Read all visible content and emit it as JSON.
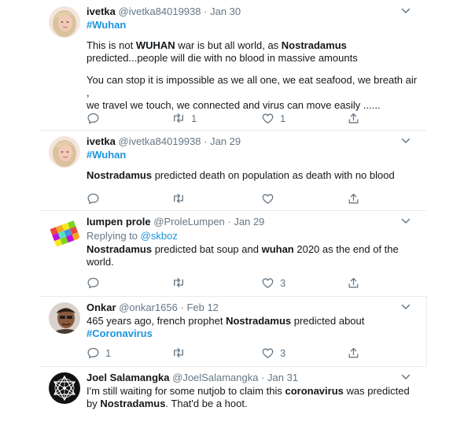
{
  "tweets": [
    {
      "name": "ivetka",
      "handle": "@ivetka84019938",
      "sep": "·",
      "date": "Jan 30",
      "hashtag": "#Wuhan",
      "text": [
        [
          "This is not ",
          "WUHAN",
          " war is but all world, as ",
          "Nostradamus"
        ],
        [
          " predicted...people will die with no blood  in massive amounts"
        ],
        [
          "You can stop it is impossible as we all one, we eat seafood, we breath air ,"
        ],
        [
          " we travel  we touch, we connected and virus can move easily ......"
        ]
      ],
      "retweets": "1",
      "likes": "1",
      "colors": {
        "avatar_bg": "#f3e4dc",
        "hair": "#d9c29c",
        "face": "#f2cbb8"
      }
    },
    {
      "name": "ivetka",
      "handle": "@ivetka84019938",
      "sep": "·",
      "date": "Jan 29",
      "hashtag": "#Wuhan",
      "bold": "Nostradamus",
      "rest": " predicted death on population as death with no blood"
    },
    {
      "name": "lumpen prole",
      "handle": "@ProleLumpen",
      "sep": "·",
      "date": "Jan 29",
      "replying": "Replying to ",
      "mention": "@skboz",
      "line1_b1": "Nostradamus",
      "line1_m": " predicted bat soup and ",
      "line1_b2": "wuhan",
      "line1_e": " 2020 as the end of the",
      "line2": "world.",
      "likes": "3"
    },
    {
      "name": "Onkar",
      "handle": "@onkar1656",
      "sep": "·",
      "date": "Feb 12",
      "line1_a": "465 years ago, french prophet ",
      "line1_b": "Nostradamus",
      "line1_c": " predicted about",
      "hashtag": "#Coronavirus",
      "replies": "1",
      "likes": "3"
    },
    {
      "name": "Joel Salamangka",
      "handle": "@JoelSalamangka",
      "sep": "·",
      "date": "Jan 31",
      "line1_a": "I'm still waiting for some nutjob to claim this ",
      "line1_b": "coronavirus",
      "line1_c": " was predicted",
      "line2_a": "by ",
      "line2_b": "Nostradamus",
      "line2_c": ". That'd be a hoot."
    }
  ],
  "icons": {
    "reply": "reply-icon",
    "retweet": "retweet-icon",
    "like": "heart-icon",
    "share": "share-icon",
    "menu": "chevron-down-icon"
  },
  "colors": {
    "link": "#1b95e0",
    "muted": "#657786",
    "text": "#14171a",
    "border": "#e6ecf0"
  }
}
